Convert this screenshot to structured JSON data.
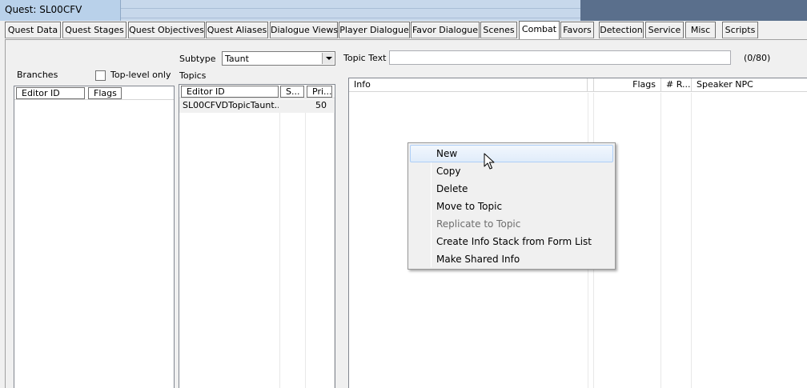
{
  "window": {
    "title": "Quest: SL00CFV"
  },
  "tabs": [
    {
      "label": "Quest Data"
    },
    {
      "label": "Quest Stages"
    },
    {
      "label": "Quest Objectives"
    },
    {
      "label": "Quest Aliases"
    },
    {
      "label": "Dialogue Views"
    },
    {
      "label": "Player Dialogue"
    },
    {
      "label": "Favor Dialogue"
    },
    {
      "label": "Scenes"
    },
    {
      "label": "Combat"
    },
    {
      "label": "Favors"
    },
    {
      "label": "Detection"
    },
    {
      "label": "Service"
    },
    {
      "label": "Misc"
    },
    {
      "label": "Scripts"
    }
  ],
  "active_tab": "Combat",
  "branches": {
    "label": "Branches",
    "top_level_only_label": "Top-level only",
    "top_level_only_checked": false,
    "columns": [
      "Editor ID",
      "Flags"
    ]
  },
  "subtype": {
    "label": "Subtype",
    "value": "Taunt"
  },
  "topics": {
    "label": "Topics",
    "columns": [
      "Editor ID",
      "S...",
      "Pri..."
    ],
    "rows": [
      {
        "editor_id": "SL00CFVDTopicTaunt...",
        "s": "",
        "priority": "50"
      }
    ]
  },
  "topic_text": {
    "label": "Topic Text",
    "value": "",
    "counter": "(0/80)"
  },
  "info_list": {
    "columns": [
      "Info",
      "Flags",
      "# R...",
      "Speaker NPC"
    ]
  },
  "context_menu": {
    "items": [
      {
        "label": "New",
        "state": "hover"
      },
      {
        "label": "Copy",
        "state": "normal"
      },
      {
        "label": "Delete",
        "state": "normal"
      },
      {
        "label": "Move to Topic",
        "state": "normal"
      },
      {
        "label": "Replicate to Topic",
        "state": "disabled"
      },
      {
        "label": "Create Info Stack from Form List",
        "state": "normal"
      },
      {
        "label": "Make Shared Info",
        "state": "normal"
      }
    ]
  },
  "icons": {
    "cursor": "arrow-cursor-icon",
    "dropdown": "chevron-down-icon"
  }
}
